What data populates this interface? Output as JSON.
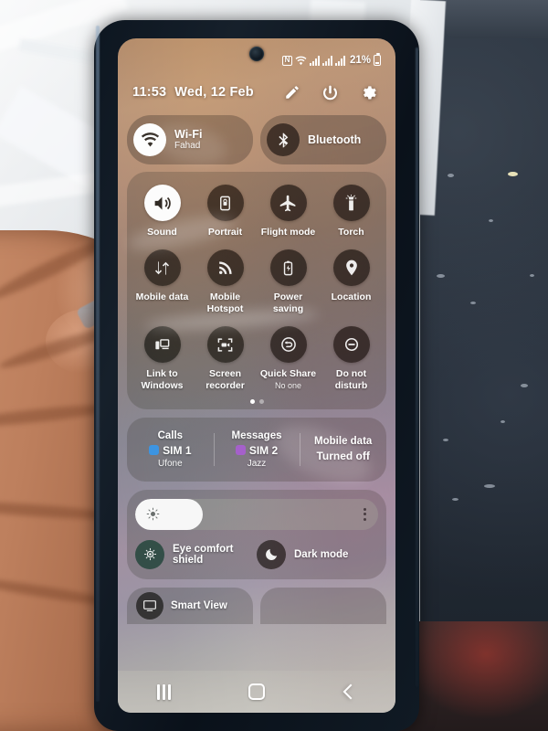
{
  "statusbar": {
    "nfc_glyph": "N",
    "battery_percent": "21%",
    "icons": [
      "nfc-icon",
      "wifi-icon",
      "signal-sim1-icon",
      "signal-roaming-icon",
      "signal-sim2-icon",
      "battery-icon"
    ]
  },
  "header": {
    "time": "11:53",
    "date": "Wed, 12 Feb",
    "actions": [
      {
        "name": "edit-button",
        "icon": "pencil-icon"
      },
      {
        "name": "power-button",
        "icon": "power-icon"
      },
      {
        "name": "settings-button",
        "icon": "gear-icon"
      }
    ]
  },
  "connectivity": [
    {
      "title": "Wi-Fi",
      "subtitle": "Fahad",
      "icon": "wifi-icon",
      "active": true
    },
    {
      "title": "Bluetooth",
      "subtitle": "",
      "icon": "bluetooth-icon",
      "active": false
    }
  ],
  "toggles": [
    {
      "label": "Sound",
      "sub": "",
      "icon": "volume-icon",
      "active": true
    },
    {
      "label": "Portrait",
      "sub": "",
      "icon": "rotation-lock-icon",
      "active": false
    },
    {
      "label": "Flight mode",
      "sub": "",
      "icon": "airplane-icon",
      "active": false
    },
    {
      "label": "Torch",
      "sub": "",
      "icon": "flashlight-icon",
      "active": false
    },
    {
      "label": "Mobile data",
      "sub": "",
      "icon": "mobile-data-icon",
      "active": false
    },
    {
      "label": "Mobile Hotspot",
      "sub": "",
      "icon": "hotspot-icon",
      "active": false
    },
    {
      "label": "Power saving",
      "sub": "",
      "icon": "power-saving-icon",
      "active": false
    },
    {
      "label": "Location",
      "sub": "",
      "icon": "location-pin-icon",
      "active": false
    },
    {
      "label": "Link to Windows",
      "sub": "",
      "icon": "link-to-windows-icon",
      "active": false
    },
    {
      "label": "Screen recorder",
      "sub": "",
      "icon": "screen-recorder-icon",
      "active": false
    },
    {
      "label": "Quick Share",
      "sub": "No one",
      "icon": "quick-share-icon",
      "active": false
    },
    {
      "label": "Do not disturb",
      "sub": "",
      "icon": "do-not-disturb-icon",
      "active": false
    }
  ],
  "pager": {
    "total": 2,
    "current": 1
  },
  "sim": [
    {
      "header": "Calls",
      "value": "SIM 1",
      "carrier": "Ufone",
      "badge_color": "#3d8fe0"
    },
    {
      "header": "Messages",
      "value": "SIM 2",
      "carrier": "Jazz",
      "badge_color": "#a259c8"
    },
    {
      "header": "Mobile data",
      "value": "Turned off",
      "carrier": "",
      "badge_color": ""
    }
  ],
  "brightness": {
    "level_percent": 28,
    "icon": "brightness-sun-icon",
    "menu_icon": "more-options-icon"
  },
  "display_modes": [
    {
      "label": "Eye comfort shield",
      "icon": "eye-comfort-icon"
    },
    {
      "label": "Dark mode",
      "icon": "moon-icon"
    }
  ],
  "cut_off_cards": [
    {
      "label": "Smart View",
      "icon": "smart-view-icon"
    },
    {
      "label": "",
      "icon": ""
    }
  ],
  "navbar": [
    {
      "name": "recents-button",
      "icon": "recents-icon"
    },
    {
      "name": "home-button",
      "icon": "home-icon"
    },
    {
      "name": "back-button",
      "icon": "back-icon"
    }
  ]
}
